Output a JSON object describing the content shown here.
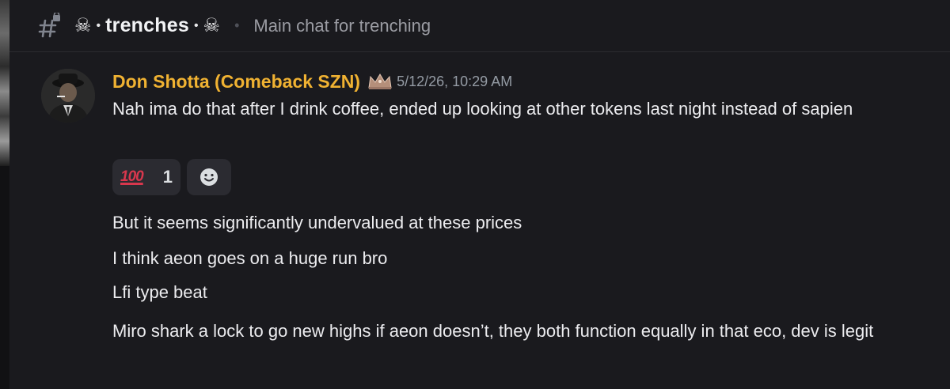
{
  "header": {
    "skull_left": "☠",
    "dot_left": "•",
    "channel_name": "trenches",
    "dot_right": "•",
    "skull_right": "☠",
    "divider": "•",
    "topic": "Main chat for trenching"
  },
  "message": {
    "username": "Don Shotta (Comeback SZN)",
    "timestamp": "5/12/26, 10:29 AM",
    "username_color": "#f0b232",
    "lines": [
      "Nah ima do that after I drink coffee, ended up looking at other tokens last night instead of sapien",
      "But it seems significantly undervalued at these prices",
      "I think aeon goes on a huge run bro",
      "Lfi type beat",
      "Miro shark a lock to go new highs if aeon doesn’t, they both function equally in that eco, dev is legit"
    ],
    "reactions": [
      {
        "emoji": "100",
        "count": "1"
      }
    ]
  },
  "icons": {
    "channel": "text-channel-locked-icon",
    "role": "crown-icon",
    "add_reaction": "smiley-add-reaction-icon"
  }
}
